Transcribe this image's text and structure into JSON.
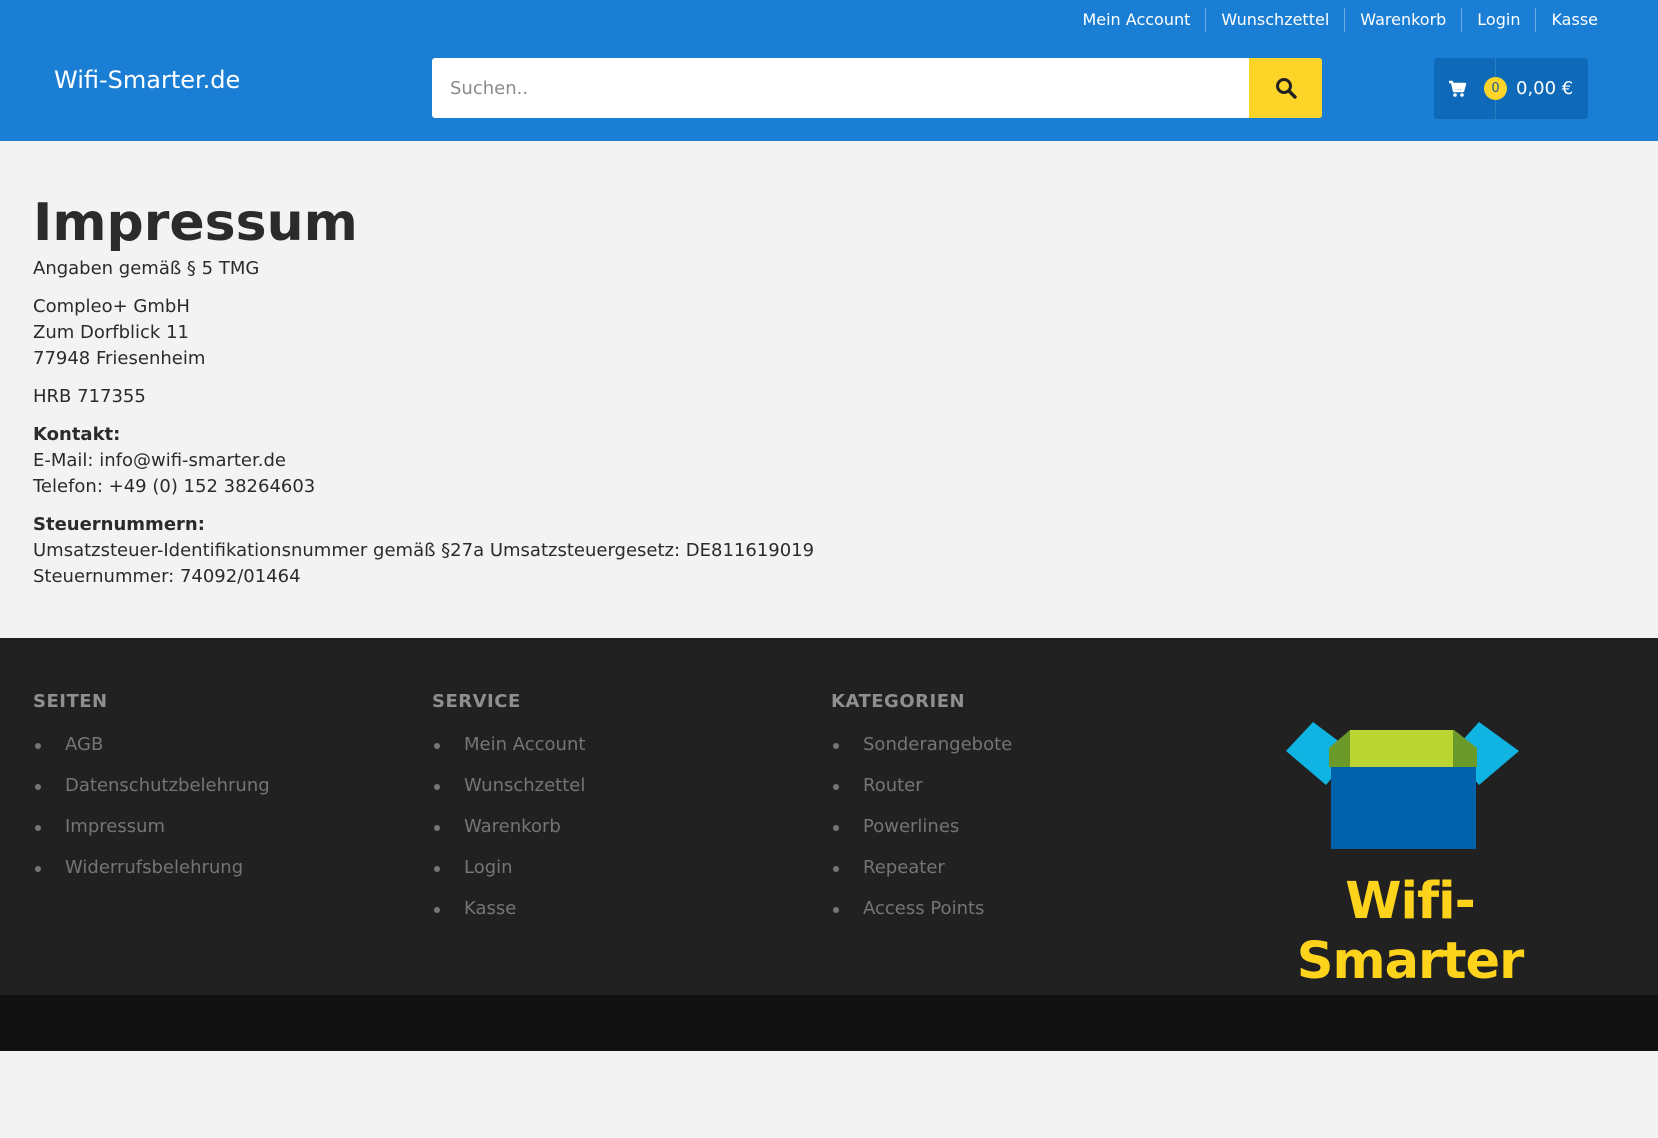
{
  "topnav": {
    "items": [
      "Mein Account",
      "Wunschzettel",
      "Warenkorb",
      "Login",
      "Kasse"
    ]
  },
  "header": {
    "site_title": "Wifi-Smarter.de",
    "search_placeholder": "Suchen..",
    "cart_count": "0",
    "cart_total": "0,00 €"
  },
  "content": {
    "title": "Impressum",
    "intro": "Angaben gemäß § 5 TMG",
    "company": "Compleo+ GmbH",
    "street": "Zum Dorfblick 11",
    "city": "77948 Friesenheim",
    "hrb": "HRB 717355",
    "contact_heading": "Kontakt:",
    "email_line": "E-Mail: info@wifi-smarter.de",
    "phone_line": "Telefon: +49 (0) 152 38264603",
    "tax_heading": "Steuernummern:",
    "vat_line": "Umsatzsteuer-Identifikationsnummer gemäß §27a Umsatzsteuergesetz: DE811619019",
    "tax_line": "Steuernummer: 74092/01464"
  },
  "footer": {
    "seiten": {
      "heading": "SEITEN",
      "items": [
        "AGB",
        "Datenschutzbelehrung",
        "Impressum",
        "Widerrufsbelehrung"
      ]
    },
    "service": {
      "heading": "SERVICE",
      "items": [
        "Mein Account",
        "Wunschzettel",
        "Warenkorb",
        "Login",
        "Kasse"
      ]
    },
    "kategorien": {
      "heading": "KATEGORIEN",
      "items": [
        "Sonderangebote",
        "Router",
        "Powerlines",
        "Repeater",
        "Access Points"
      ]
    },
    "logo_text": "Wifi-Smarter"
  },
  "colors": {
    "header_bg": "#1a7fd4",
    "accent_yellow": "#fdd428",
    "footer_bg": "#212121",
    "footer_bottom_bg": "#121212",
    "cart_bg": "#0e6ab9"
  }
}
